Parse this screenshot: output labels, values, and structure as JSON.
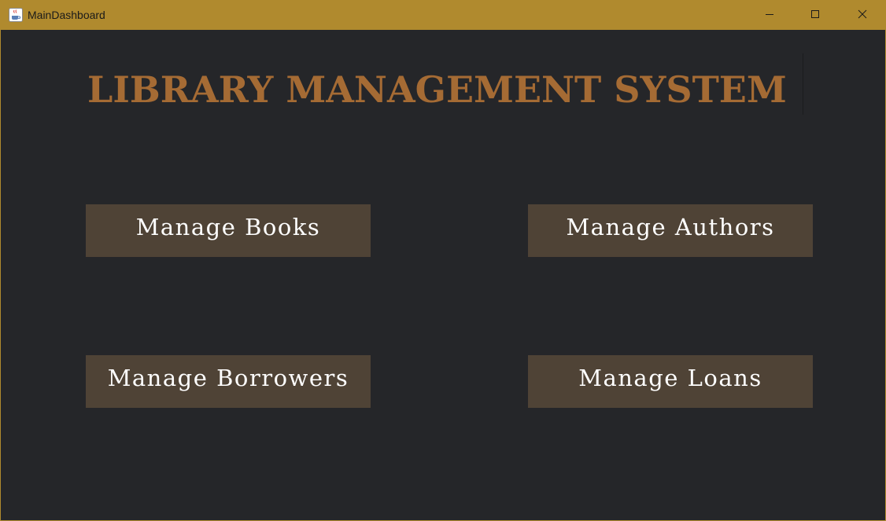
{
  "window": {
    "title": "MainDashboard",
    "app_icon": "java-coffee-cup-icon",
    "controls": {
      "minimize_icon": "minimize-icon",
      "maximize_icon": "maximize-icon",
      "close_icon": "close-icon"
    },
    "titlebar_color": "#b08a2e"
  },
  "main": {
    "heading": "LIBRARY MANAGEMENT SYSTEM",
    "heading_color": "#a56b34",
    "background_color": "#252629",
    "buttons": [
      {
        "label": "Manage Books"
      },
      {
        "label": "Manage Authors"
      },
      {
        "label": "Manage Borrowers"
      },
      {
        "label": "Manage Loans"
      }
    ],
    "button_color": "#4f4336"
  }
}
